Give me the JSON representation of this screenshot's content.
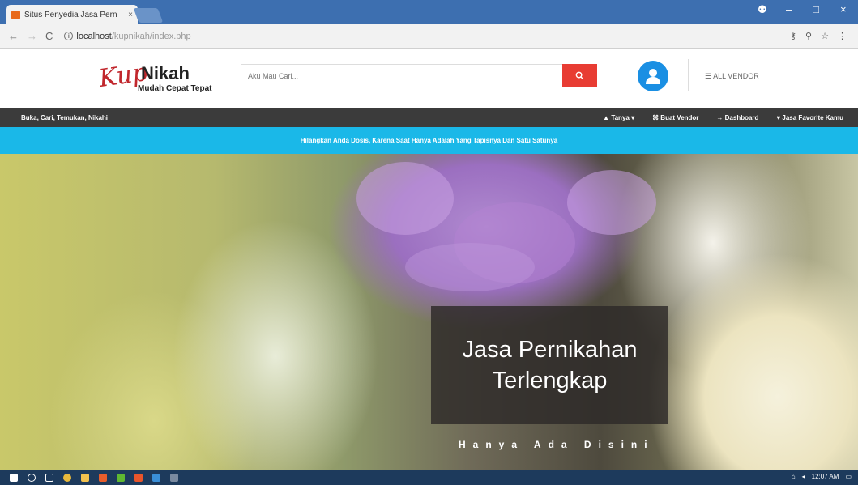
{
  "browser": {
    "tab_title": "Situs Penyedia Jasa Pern",
    "tab_close": "×",
    "url_host": "localhost",
    "url_path": "/kupnikah/index.php",
    "window_controls": {
      "minimize": "–",
      "maximize": "□",
      "close": "×"
    },
    "nav_back": "←",
    "nav_forward": "→",
    "nav_reload": "C",
    "url_info": "i",
    "toolbar_icons": "⚷ ⚲ ☆ ⋮"
  },
  "header": {
    "logo_script": "Kup",
    "logo_name": "Nikah",
    "logo_tagline": "Mudah Cepat Tepat",
    "search_placeholder": "Aku Mau Cari...",
    "search_icon": "search-icon",
    "all_vendor": "ALL VENDOR"
  },
  "nav": {
    "tagline": "Buka, Cari, Temukan, Nikahi",
    "items": [
      {
        "label": "▲ Tanya ▾"
      },
      {
        "label": "⌘ Buat Vendor"
      },
      {
        "label": "→ Dashboard"
      },
      {
        "label": "♥ Jasa Favorite Kamu"
      }
    ]
  },
  "banner": {
    "text": "Hilangkan Anda Dosis, Karena Saat Hanya Adalah Yang Tapisnya Dan Satu Satunya"
  },
  "hero": {
    "title": "Jasa Pernikahan Terlengkap",
    "subtitle": "Hanya Ada Disini"
  },
  "taskbar": {
    "time": "12:07 AM"
  },
  "colors": {
    "search_button": "#e83c33",
    "user_circle": "#1a8fe3",
    "dark_nav": "#3b3b3b",
    "banner": "#1ab8e8",
    "browser_tabbar": "#3d6fb0",
    "taskbar": "#1d3a5c"
  }
}
